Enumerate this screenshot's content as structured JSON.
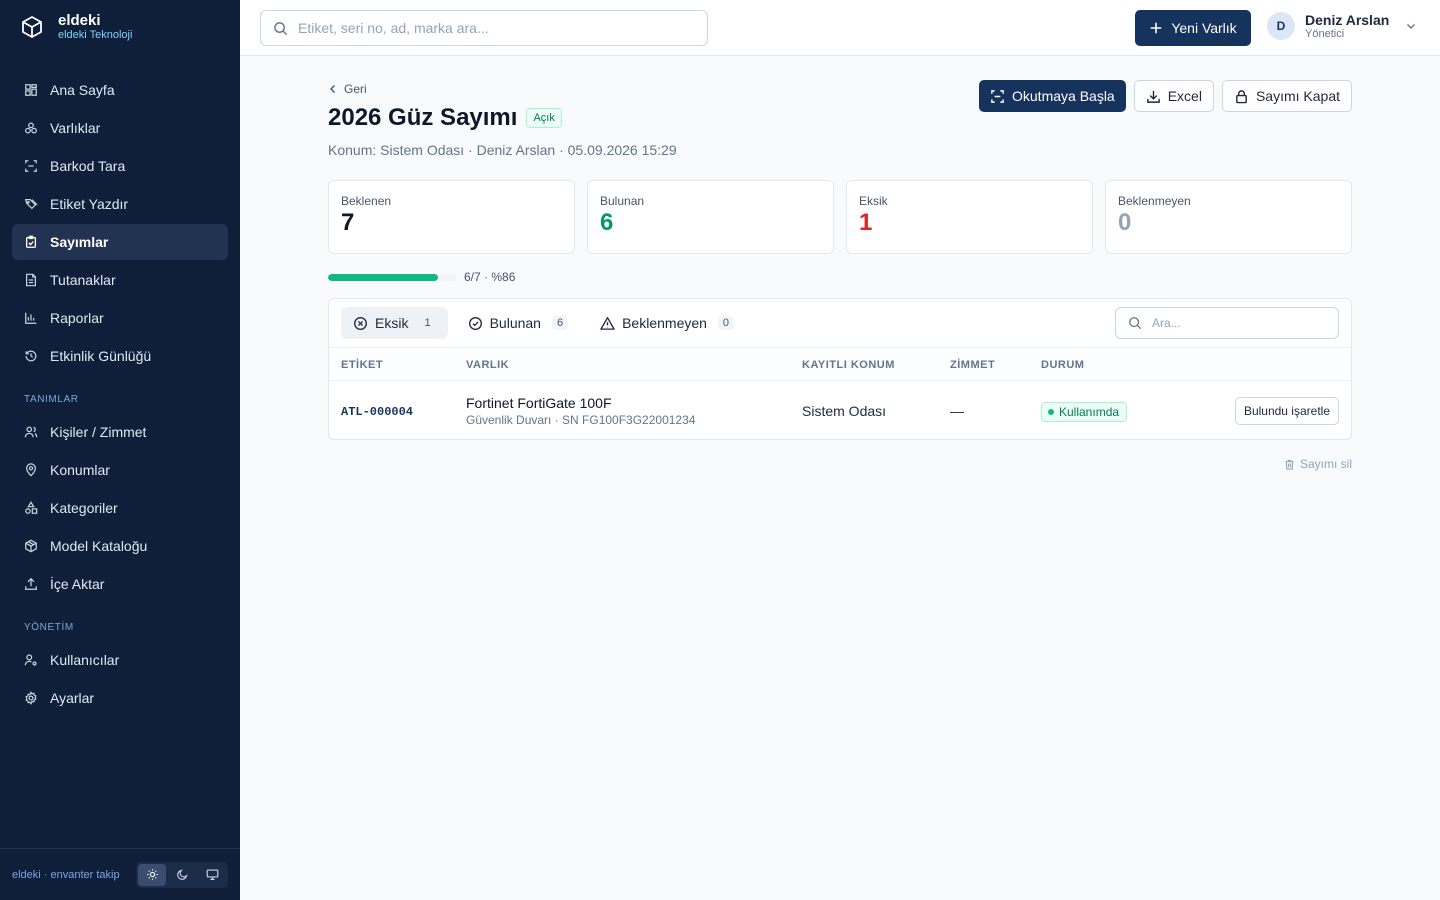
{
  "brand": {
    "name": "eldeki",
    "subtitle": "eldeki Teknoloji"
  },
  "nav": {
    "main": [
      {
        "label": "Ana Sayfa",
        "icon": "dashboard-icon"
      },
      {
        "label": "Varlıklar",
        "icon": "boxes-icon"
      },
      {
        "label": "Barkod Tara",
        "icon": "scan-icon"
      },
      {
        "label": "Etiket Yazdır",
        "icon": "tags-icon"
      },
      {
        "label": "Sayımlar",
        "icon": "clipboard-check-icon",
        "active": true
      },
      {
        "label": "Tutanaklar",
        "icon": "file-text-icon"
      },
      {
        "label": "Raporlar",
        "icon": "bar-chart-icon"
      },
      {
        "label": "Etkinlik Günlüğü",
        "icon": "history-icon"
      }
    ],
    "definitions_title": "TANIMLAR",
    "definitions": [
      {
        "label": "Kişiler / Zimmet",
        "icon": "users-icon"
      },
      {
        "label": "Konumlar",
        "icon": "map-pin-icon"
      },
      {
        "label": "Kategoriler",
        "icon": "shapes-icon"
      },
      {
        "label": "Model Kataloğu",
        "icon": "package-icon"
      },
      {
        "label": "İçe Aktar",
        "icon": "upload-icon"
      }
    ],
    "admin_title": "YÖNETİM",
    "admin": [
      {
        "label": "Kullanıcılar",
        "icon": "user-cog-icon"
      },
      {
        "label": "Ayarlar",
        "icon": "gear-icon"
      }
    ]
  },
  "footer": {
    "text": "eldeki · envanter takip",
    "theme_active": "light"
  },
  "topbar": {
    "search_placeholder": "Etiket, seri no, ad, marka ara...",
    "new_asset_label": "Yeni Varlık",
    "user": {
      "initial": "D",
      "name": "Deniz Arslan",
      "role": "Yönetici"
    }
  },
  "page": {
    "back_label": "Geri",
    "title": "2026 Güz Sayımı",
    "status": "Açık",
    "meta": "Konum: Sistem Odası · Deniz Arslan · 05.09.2026 15:29",
    "actions": {
      "start_scan": "Okutmaya Başla",
      "excel": "Excel",
      "close_count": "Sayımı Kapat"
    },
    "stats": [
      {
        "label": "Beklenen",
        "value": "7",
        "color": "#0f172a"
      },
      {
        "label": "Bulunan",
        "value": "6",
        "color": "#059669"
      },
      {
        "label": "Eksik",
        "value": "1",
        "color": "#dc2626"
      },
      {
        "label": "Beklenmeyen",
        "value": "0",
        "color": "#94a3b8"
      }
    ],
    "progress": {
      "fraction": 0.86,
      "text": "6/7 · %86"
    },
    "tabs": [
      {
        "label": "Eksik",
        "count": "1",
        "active": true
      },
      {
        "label": "Bulunan",
        "count": "6"
      },
      {
        "label": "Beklenmeyen",
        "count": "0"
      }
    ],
    "table_search_placeholder": "Ara...",
    "table": {
      "headers": [
        "ETİKET",
        "VARLIK",
        "KAYITLI KONUM",
        "ZİMMET",
        "DURUM"
      ],
      "rows": [
        {
          "tag": "ATL-000004",
          "name": "Fortinet FortiGate 100F",
          "sub": "Güvenlik Duvarı · SN FG100F3G22001234",
          "location": "Sistem Odası",
          "assignee": "—",
          "status": "Kullanımda",
          "action": "Bulundu işaretle"
        }
      ]
    },
    "delete_label": "Sayımı sil"
  },
  "colors": {
    "sidebar": "#0f1f3a",
    "primary": "#16335e",
    "success": "#10b981",
    "danger": "#dc2626"
  }
}
